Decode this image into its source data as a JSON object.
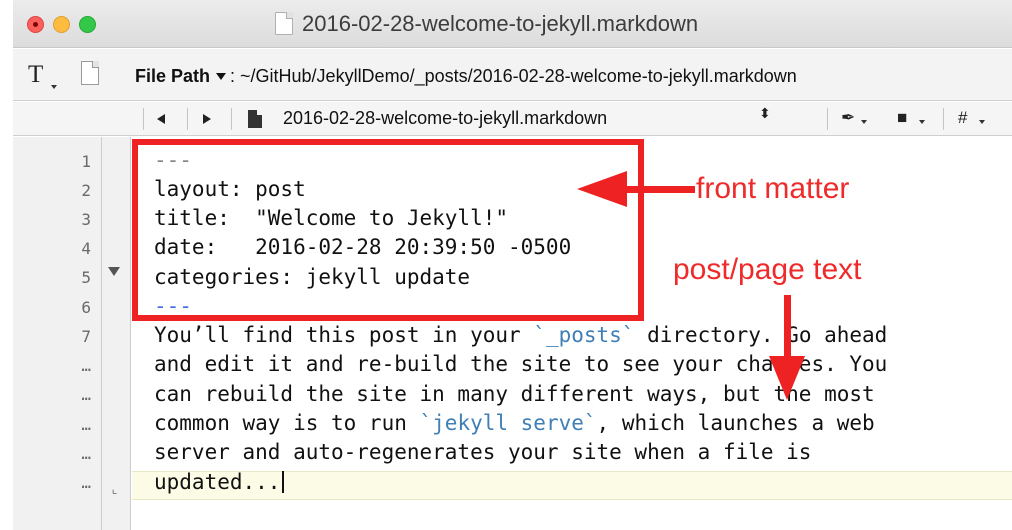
{
  "window": {
    "title": "2016-02-28-welcome-to-jekyll.markdown"
  },
  "toolbar": {
    "t_glyph": "T",
    "file_path_label": "File Path",
    "file_path_value": ": ~/GitHub/JekyllDemo/_posts/2016-02-28-welcome-to-jekyll.markdown"
  },
  "navbar": {
    "filename": "2016-02-28-welcome-to-jekyll.markdown",
    "updown_glyph": "⬍",
    "pen_glyph": "✒",
    "square_glyph": "■",
    "hash_glyph": "#"
  },
  "editor": {
    "line_numbers": [
      "1",
      "2",
      "3",
      "4",
      "5",
      "6",
      "7",
      "…",
      "…",
      "…",
      "…",
      "…"
    ],
    "front_matter": {
      "open": "---",
      "layout": "layout: post",
      "title": "title:  \"Welcome to Jekyll!\"",
      "date": "date:   2016-02-28 20:39:50 -0500",
      "categories": "categories: jekyll update",
      "close": "---"
    },
    "body": {
      "l1_a": "You’ll find this post in your ",
      "l1_code": "`_posts`",
      "l1_b": " directory. Go ahead",
      "l2": "and edit it and re-build the site to see your changes. You",
      "l3": "can rebuild the site in many different ways, but the most",
      "l4_a": "common way is to run ",
      "l4_code": "`jekyll serve`",
      "l4_b": ", which launches a web",
      "l5": "server and auto-regenerates your site when a file is",
      "l6": "updated..."
    },
    "wrap_glyph": "⌞"
  },
  "annotations": {
    "front_matter": "front matter",
    "post_text": "post/page text",
    "color": "#ee2222"
  }
}
